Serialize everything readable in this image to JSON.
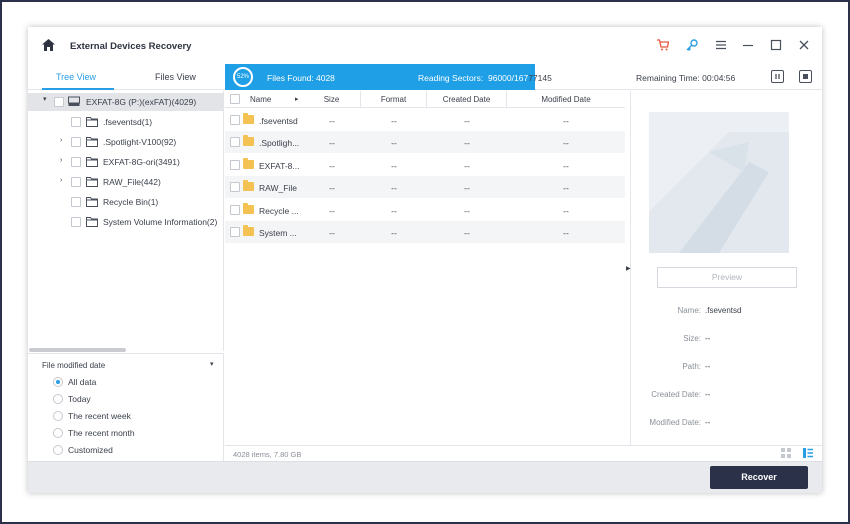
{
  "window": {
    "title": "External Devices Recovery"
  },
  "tabs": {
    "tree_view": "Tree View",
    "files_view": "Files View"
  },
  "scan": {
    "percent": "52%",
    "progress_fraction": 0.52,
    "files_found_label": "Files Found:",
    "files_found_value": "4028",
    "reading_sectors_label": "Reading Sectors:",
    "reading_sectors_value": "96000/16777145",
    "remaining_time_label": "Remaining Time:",
    "remaining_time_value": "00:04:56"
  },
  "tree": {
    "root": "EXFAT-8G (P:)(exFAT)(4029)",
    "items": [
      {
        "label": ".fseventsd(1)",
        "expandable": false
      },
      {
        "label": ".Spotlight-V100(92)",
        "expandable": true
      },
      {
        "label": "EXFAT-8G-ori(3491)",
        "expandable": true
      },
      {
        "label": "RAW_File(442)",
        "expandable": true
      },
      {
        "label": "Recycle Bin(1)",
        "expandable": false
      },
      {
        "label": "System Volume Information(2)",
        "expandable": false
      }
    ]
  },
  "filter": {
    "title": "File modified date",
    "options": [
      "All data",
      "Today",
      "The recent week",
      "The recent month",
      "Customized"
    ],
    "selected": "All data"
  },
  "table": {
    "columns": [
      "Name",
      "Size",
      "Format",
      "Created Date",
      "Modified Date"
    ],
    "rows": [
      {
        "name": ".fseventsd",
        "size": "--",
        "format": "--",
        "created": "--",
        "modified": "--"
      },
      {
        "name": ".Spotligh...",
        "size": "--",
        "format": "--",
        "created": "--",
        "modified": "--"
      },
      {
        "name": "EXFAT-8...",
        "size": "--",
        "format": "--",
        "created": "--",
        "modified": "--"
      },
      {
        "name": "RAW_File",
        "size": "--",
        "format": "--",
        "created": "--",
        "modified": "--"
      },
      {
        "name": "Recycle ...",
        "size": "--",
        "format": "--",
        "created": "--",
        "modified": "--"
      },
      {
        "name": "System ...",
        "size": "--",
        "format": "--",
        "created": "--",
        "modified": "--"
      }
    ],
    "footer": "4028 items, 7.80  GB"
  },
  "preview": {
    "button": "Preview",
    "name_label": "Name:",
    "name_value": ".fseventsd",
    "size_label": "Size:",
    "size_value": "--",
    "path_label": "Path:",
    "path_value": "--",
    "created_label": "Created Date:",
    "created_value": "--",
    "modified_label": "Modified Date:",
    "modified_value": "--"
  },
  "actions": {
    "recover": "Recover"
  },
  "colors": {
    "accent": "#1e9fe6",
    "dark": "#2b3148",
    "folder": "#f4c253",
    "cart": "#e8573f",
    "key": "#2a9ee4"
  }
}
